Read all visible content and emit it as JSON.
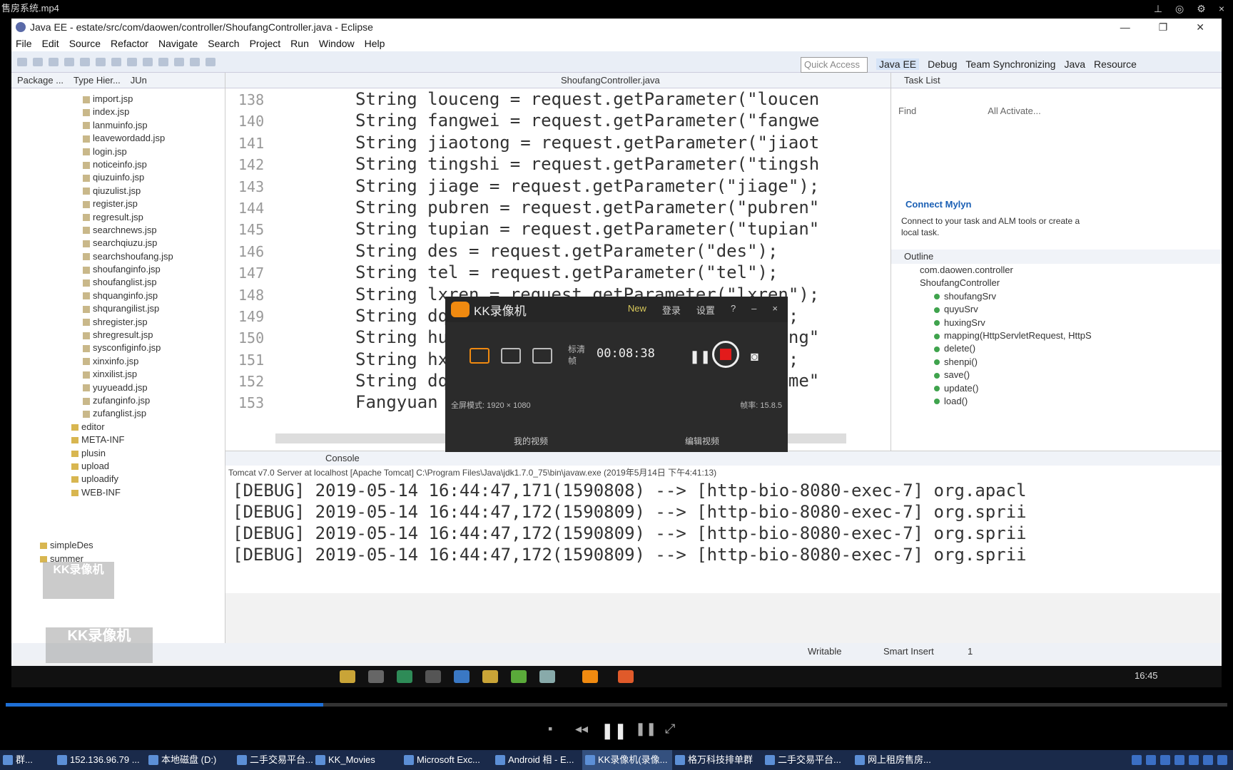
{
  "player": {
    "title": "售房系统.mp4"
  },
  "eclipse": {
    "window_title": "Java EE - estate/src/com/daowen/controller/ShoufangController.java - Eclipse",
    "menu": [
      "File",
      "Edit",
      "Source",
      "Refactor",
      "Navigate",
      "Search",
      "Project",
      "Run",
      "Window",
      "Help"
    ],
    "quick_access": "Quick Access",
    "perspectives": [
      "Java EE",
      "Debug",
      "Team Synchronizing",
      "Java",
      "Resource"
    ]
  },
  "explorer": {
    "tabs": [
      "Package ...",
      "Type Hier...",
      "JUn"
    ],
    "files": [
      "import.jsp",
      "index.jsp",
      "lanmuinfo.jsp",
      "leavewordadd.jsp",
      "login.jsp",
      "noticeinfo.jsp",
      "qiuzuinfo.jsp",
      "qiuzulist.jsp",
      "register.jsp",
      "regresult.jsp",
      "searchnews.jsp",
      "searchqiuzu.jsp",
      "searchshoufang.jsp",
      "shoufanginfo.jsp",
      "shoufanglist.jsp",
      "shquanginfo.jsp",
      "shqurangilist.jsp",
      "shregister.jsp",
      "shregresult.jsp",
      "sysconfiginfo.jsp",
      "xinxinfo.jsp",
      "xinxilist.jsp",
      "yuyueadd.jsp",
      "zufanginfo.jsp",
      "zufanglist.jsp"
    ],
    "folders": [
      "editor",
      "META-INF",
      "plusin",
      "upload",
      "uploadify",
      "WEB-INF",
      "simpleDes",
      "summer"
    ]
  },
  "editor": {
    "tab": "ShoufangController.java",
    "lines": [
      {
        "num": "138",
        "text": "String louceng = request.getParameter(\"loucen"
      },
      {
        "num": "140",
        "text": "String fangwei = request.getParameter(\"fangwe"
      },
      {
        "num": "141",
        "text": "String jiaotong = request.getParameter(\"jiaot"
      },
      {
        "num": "142",
        "text": "String tingshi = request.getParameter(\"tingsh"
      },
      {
        "num": "143",
        "text": "String jiage = request.getParameter(\"jiage\");"
      },
      {
        "num": "144",
        "text": "String pubren = request.getParameter(\"pubren\""
      },
      {
        "num": "145",
        "text": "String tupian = request.getParameter(\"tupian\""
      },
      {
        "num": "146",
        "text": "String des = request.getParameter(\"des\");"
      },
      {
        "num": "147",
        "text": "String tel = request.getParameter(\"tel\");"
      },
      {
        "num": "148",
        "text": "String lxren = request.getParameter(\"lxren\");"
      },
      {
        "num": "149",
        "text": "String dqid = request.getParameter(\"dqid\");"
      },
      {
        "num": "150",
        "text": "String huxing = request.getParameter(\"huxing\""
      },
      {
        "num": "151",
        "text": "String hxid = request.getParameter(\"hxid\");"
      },
      {
        "num": "152",
        "text": "String dqname = request.getParameter(\"dqname\""
      },
      {
        "num": "153",
        "text": "Fangyuan"
      }
    ]
  },
  "right": {
    "task_list": "Task List",
    "find": "Find",
    "all": "All",
    "activate": "Activate...",
    "connect_title": "Connect Mylyn",
    "connect_desc": "Connect to your task and ALM tools or create a local task.",
    "outline_title": "Outline",
    "outline": [
      "com.daowen.controller",
      "ShoufangController",
      "shoufangSrv",
      "quyuSrv",
      "huxingSrv",
      "mapping(HttpServletRequest, HttpS",
      "delete()",
      "shenpi()",
      "save()",
      "update()",
      "load()"
    ]
  },
  "console": {
    "tab": "Console",
    "desc": "Tomcat v7.0 Server at localhost [Apache Tomcat] C:\\Program Files\\Java\\jdk1.7.0_75\\bin\\javaw.exe (2019年5月14日 下午4:41:13)",
    "lines": [
      "[DEBUG] 2019-05-14 16:44:47,171(1590808) --> [http-bio-8080-exec-7] org.apacl",
      "[DEBUG] 2019-05-14 16:44:47,172(1590809) --> [http-bio-8080-exec-7] org.sprii",
      "[DEBUG] 2019-05-14 16:44:47,172(1590809) --> [http-bio-8080-exec-7] org.sprii",
      "[DEBUG] 2019-05-14 16:44:47,172(1590809) --> [http-bio-8080-exec-7] org.sprii"
    ]
  },
  "status": {
    "writable": "Writable",
    "insert": "Smart Insert",
    "pos": "1"
  },
  "kk": {
    "name": "KK录像机",
    "links": [
      "New",
      "登录",
      "设置",
      "?",
      "–",
      "×"
    ],
    "label": "标清 帧",
    "time": "00:08:38",
    "info": "全屏模式: 1920 × 1080",
    "fps": "帧率: 15.8.5",
    "footer": [
      "我的视频",
      "编辑视频"
    ]
  },
  "watermark": {
    "top": "KK录像机",
    "bottom": "KK录像机"
  },
  "inner_clock": "16:45",
  "progress": {
    "fraction": 0.26
  },
  "os_taskbar": {
    "tasks": [
      "群...",
      "152.136.96.79 ...",
      "本地磁盘 (D:)",
      "二手交易平台...",
      "KK_Movies",
      "Microsoft Exc...",
      "Android 相 - E...",
      "KK录像机(录像...",
      "格万科技排单群",
      "二手交易平台...",
      "网上租房售房..."
    ]
  }
}
